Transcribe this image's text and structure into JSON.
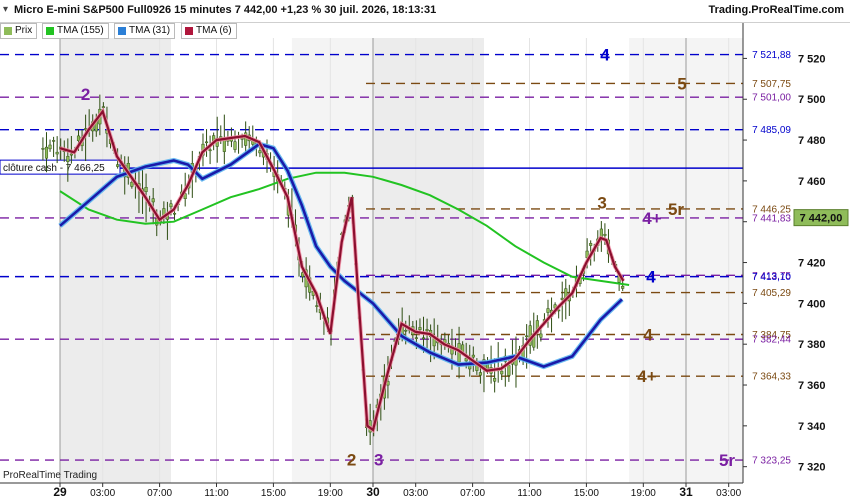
{
  "header": {
    "title": "Micro E-mini S&P500 Full0926 15 minutes 7 442,00 +1,23 % 30 juil. 2026, 18:13:31",
    "site": "Trading.ProRealTime.com",
    "collapse_icon": "chevron-down-icon"
  },
  "legend": {
    "items": [
      {
        "label": "Prix",
        "color": "#8fbc5a"
      },
      {
        "label": "TMA (155)",
        "color": "#22c322"
      },
      {
        "label": "TMA (31)",
        "color": "#2b7fd6"
      },
      {
        "label": "TMA (6)",
        "color": "#b0163c"
      }
    ]
  },
  "watermark": "ProRealTime Trading",
  "colors": {
    "candles": "#8fbc5a",
    "candle_wick": "#2d4d12",
    "tma155": "#22c322",
    "tma31_fast": "#1a1aaa",
    "tma31_slow": "#5ab4f0",
    "tma6_up": "#8b0f2f",
    "tma6_down": "#f08aa0",
    "blue_levels": "#0000cc",
    "purple_levels": "#7a1fa2",
    "brown_levels": "#7b4a12",
    "close_line": "#0000cc"
  },
  "chart_data": {
    "type": "line",
    "ylim": [
      7312,
      7530
    ],
    "y_ticks": [
      {
        "v": 7320,
        "t": "7 320"
      },
      {
        "v": 7340,
        "t": "7 340"
      },
      {
        "v": 7360,
        "t": "7 360"
      },
      {
        "v": 7380,
        "t": "7 380"
      },
      {
        "v": 7400,
        "t": "7 400"
      },
      {
        "v": 7420,
        "t": "7 420"
      },
      {
        "v": 7440,
        "t": "7 440"
      },
      {
        "v": 7460,
        "t": "7 460"
      },
      {
        "v": 7480,
        "t": "7 480"
      },
      {
        "v": 7500,
        "t": "7 500"
      },
      {
        "v": 7520,
        "t": "7 520"
      }
    ],
    "x_ticks": [
      {
        "t": 0,
        "label": "29",
        "bold": true
      },
      {
        "t": 3,
        "label": "03:00"
      },
      {
        "t": 7,
        "label": "07:00"
      },
      {
        "t": 11,
        "label": "11:00"
      },
      {
        "t": 15,
        "label": "15:00"
      },
      {
        "t": 19,
        "label": "19:00"
      },
      {
        "t": 22,
        "label": "30",
        "bold": true
      },
      {
        "t": 25,
        "label": "03:00"
      },
      {
        "t": 29,
        "label": "07:00"
      },
      {
        "t": 33,
        "label": "11:00"
      },
      {
        "t": 37,
        "label": "15:00"
      },
      {
        "t": 41,
        "label": "19:00"
      },
      {
        "t": 44,
        "label": "31",
        "bold": true
      },
      {
        "t": 47,
        "label": "03:00"
      }
    ],
    "levels": [
      {
        "value": 7521.88,
        "label": "7 521,88",
        "color": "blue",
        "start": "left",
        "tag": "4"
      },
      {
        "value": 7507.75,
        "label": "7 507,75",
        "color": "brown",
        "start": "mid",
        "tag": "5"
      },
      {
        "value": 7501.0,
        "label": "7 501,00",
        "color": "purple",
        "start": "left",
        "tag": ""
      },
      {
        "value": 7485.09,
        "label": "7 485,09",
        "color": "blue",
        "start": "left",
        "tag": ""
      },
      {
        "value": 7446.25,
        "label": "7 446,25",
        "color": "brown",
        "start": "mid",
        "tag": "5r"
      },
      {
        "value": 7441.83,
        "label": "7 441,83",
        "color": "purple",
        "start": "left",
        "tag": "4+"
      },
      {
        "value": 7413.75,
        "label": "7 413,75",
        "color": "purple",
        "start": "mid",
        "tag": ""
      },
      {
        "value": 7413.1,
        "label": "7 413,10",
        "color": "blue",
        "start": "left",
        "tag": "4"
      },
      {
        "value": 7405.29,
        "label": "7 405,29",
        "color": "brown",
        "start": "mid",
        "tag": ""
      },
      {
        "value": 7384.75,
        "label": "7 384,75",
        "color": "brown",
        "start": "mid",
        "tag": "4"
      },
      {
        "value": 7382.44,
        "label": "7 382,44",
        "color": "purple",
        "start": "left",
        "tag": ""
      },
      {
        "value": 7364.33,
        "label": "7 364,33",
        "color": "brown",
        "start": "mid",
        "tag": "4+"
      },
      {
        "value": 7323.25,
        "label": "7 323,25",
        "color": "purple",
        "start": "left",
        "tag": "5r"
      }
    ],
    "close_reference": {
      "value": 7466.25,
      "label": "clôture cash - 7 466,25"
    },
    "last_price": {
      "value": 7442.0,
      "label": "7 442,00"
    },
    "wave_labels": [
      {
        "text": "2",
        "t": 1.8,
        "y": 7502,
        "color": "purple"
      },
      {
        "text": "2",
        "t": 20.5,
        "y": 7323,
        "color": "brown"
      },
      {
        "text": "3",
        "t": 22.4,
        "y": 7323,
        "color": "purple"
      },
      {
        "text": "3",
        "t": 38.1,
        "y": 7449,
        "color": "brown"
      }
    ],
    "series": [
      {
        "name": "TMA (155)",
        "color": "#22c322",
        "x": [
          0,
          2,
          4,
          6,
          8,
          10,
          12,
          14,
          16,
          18,
          20,
          22,
          24,
          26,
          28,
          30,
          32,
          34,
          36,
          38,
          40
        ],
        "y": [
          7455,
          7446,
          7441,
          7439,
          7440,
          7446,
          7452,
          7456,
          7461,
          7464,
          7464,
          7462,
          7458,
          7453,
          7446,
          7438,
          7428,
          7420,
          7413,
          7411,
          7409
        ]
      },
      {
        "name": "TMA (31)",
        "color": "#1a1aaa",
        "x": [
          0,
          2,
          4,
          6,
          8,
          9,
          10,
          12,
          14,
          15,
          16,
          17,
          18,
          19,
          20,
          22,
          24,
          26,
          28,
          30,
          32,
          34,
          36,
          38,
          39.5
        ],
        "y": [
          7438,
          7450,
          7462,
          7467,
          7470,
          7468,
          7461,
          7468,
          7478,
          7476,
          7465,
          7448,
          7428,
          7418,
          7411,
          7400,
          7384,
          7376,
          7370,
          7371,
          7374,
          7369,
          7374,
          7392,
          7402
        ]
      },
      {
        "name": "TMA (6)",
        "color": "#b0163c",
        "x": [
          0,
          1,
          2,
          3,
          4,
          5,
          6,
          7,
          8,
          9,
          10,
          11,
          12,
          13,
          14,
          15,
          16,
          17,
          18,
          19,
          19.8,
          20.5,
          21,
          21.6,
          22,
          23,
          24,
          25,
          26,
          27,
          28,
          29,
          30,
          31,
          32,
          33,
          34,
          35,
          36,
          37,
          38,
          38.4,
          39,
          39.6
        ],
        "y": [
          7476,
          7474,
          7485,
          7494,
          7472,
          7462,
          7452,
          7441,
          7446,
          7458,
          7474,
          7480,
          7481,
          7482,
          7479,
          7466,
          7452,
          7418,
          7405,
          7385,
          7430,
          7452,
          7400,
          7340,
          7338,
          7365,
          7390,
          7386,
          7385,
          7380,
          7377,
          7372,
          7367,
          7368,
          7373,
          7382,
          7390,
          7398,
          7405,
          7420,
          7432,
          7431,
          7418,
          7411
        ]
      }
    ]
  }
}
